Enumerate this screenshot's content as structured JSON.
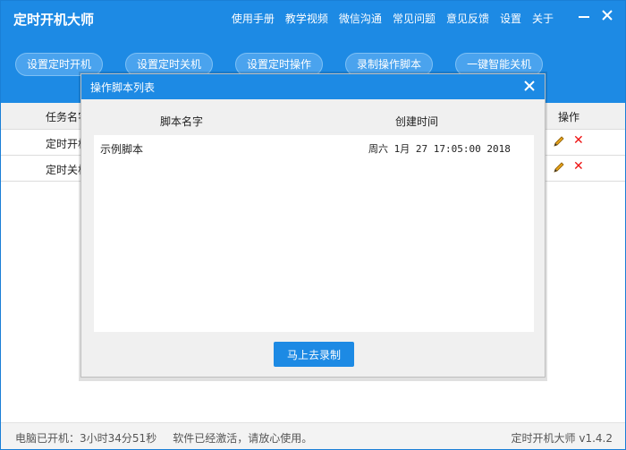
{
  "app": {
    "title": "定时开机大师",
    "nav": [
      "使用手册",
      "教学视频",
      "微信沟通",
      "常见问题",
      "意见反馈",
      "设置",
      "关于"
    ]
  },
  "actions": [
    "设置定时开机",
    "设置定时关机",
    "设置定时操作",
    "录制操作脚本",
    "一键智能关机"
  ],
  "tasks": {
    "headers": {
      "name": "任务名字",
      "ops": "操作"
    },
    "rows": [
      {
        "name": "定时开机"
      },
      {
        "name": "定时关机"
      }
    ]
  },
  "status": {
    "uptime_label": "电脑已开机：",
    "uptime": "3小时34分51秒",
    "activation": "软件已经激活，请放心使用。",
    "app_version": "定时开机大师 v1.4.2"
  },
  "dialog": {
    "title": "操作脚本列表",
    "col_name": "脚本名字",
    "col_created": "创建时间",
    "scripts": [
      {
        "name": "示例脚本",
        "created": "周六 1月 27 17:05:00 2018"
      }
    ],
    "record_button": "马上去录制"
  },
  "colors": {
    "brand": "#1d8ae4",
    "delete": "#e11111"
  }
}
